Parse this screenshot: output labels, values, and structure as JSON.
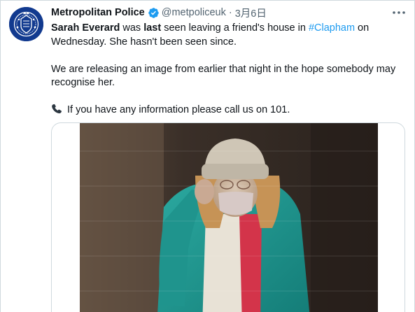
{
  "tweet": {
    "author": {
      "name": "Metropolitan Police",
      "handle": "@metpoliceuk",
      "verified": true,
      "avatar_icon": "met-police-crest-icon"
    },
    "separator": "·",
    "date": "3月6日",
    "paragraphs": {
      "p1": {
        "name": "Sarah Everard",
        "t1": " was ",
        "last": "last",
        "t2": " seen leaving a friend's house in ",
        "hashtag": "#Clapham",
        "t3": " on Wednesday. She hasn't been seen since."
      },
      "p2": "We are releasing an image from earlier that night in the hope somebody may recognise her.",
      "p3": "If you have any information please call us on 101."
    },
    "media": {
      "type": "cctv-image"
    }
  },
  "colors": {
    "link": "#1d9bf0",
    "verified": "#1d9bf0",
    "muted": "#536471",
    "avatar_bg": "#123a8f"
  }
}
